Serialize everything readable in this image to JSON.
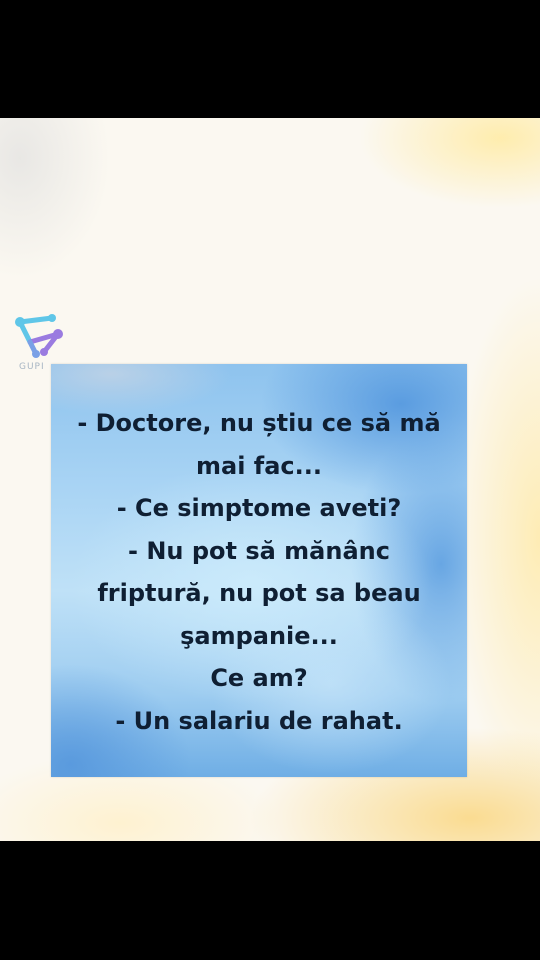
{
  "watermark": {
    "text": "GUPI",
    "icon": "network-nodes-logo-icon",
    "colors": [
      "#5fc6e8",
      "#9a7be0"
    ]
  },
  "joke": {
    "lines": [
      "- Doctore, nu știu ce să mă",
      "mai fac...",
      "- Ce simptome aveti?",
      "- Nu pot să mănânc",
      "friptură, nu pot sa beau",
      "şampanie...",
      "Ce am?",
      "- Un salariu de rahat."
    ]
  }
}
